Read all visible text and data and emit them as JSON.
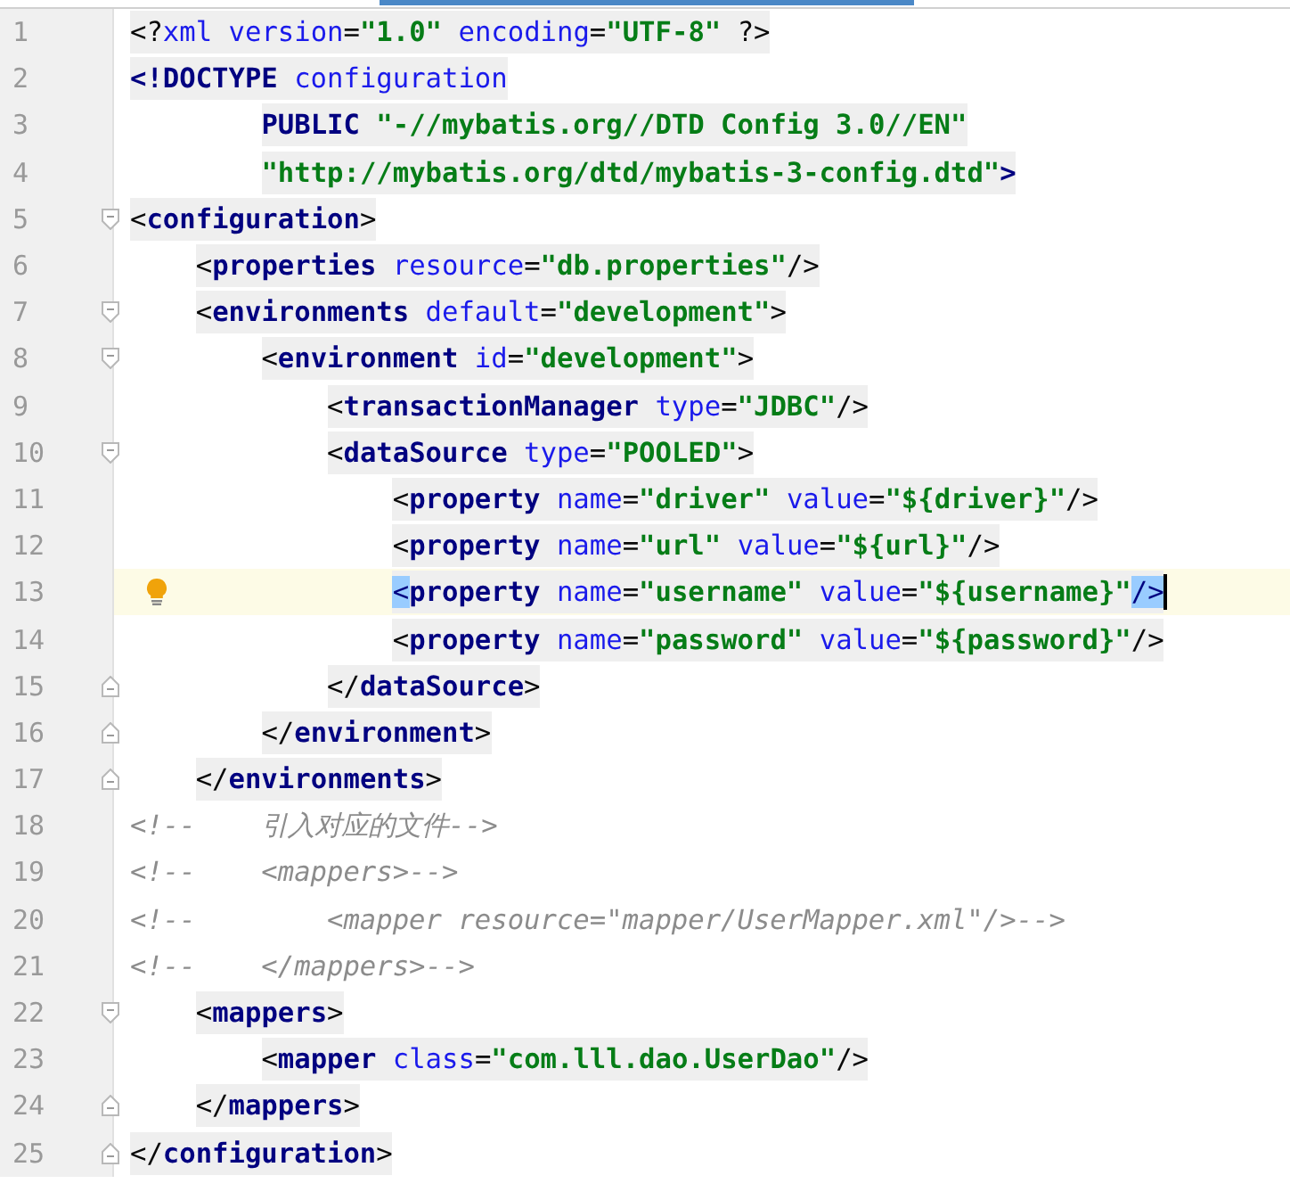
{
  "lines": [
    {
      "number": "1",
      "tokens": [
        {
          "kind": "punct",
          "text": "<?"
        },
        {
          "kind": "attr",
          "text": "xml"
        },
        {
          "kind": "attr",
          "text": " version"
        },
        {
          "kind": "punct",
          "text": "="
        },
        {
          "kind": "value",
          "text": "\"1.0\""
        },
        {
          "kind": "attr",
          "text": " encoding"
        },
        {
          "kind": "punct",
          "text": "="
        },
        {
          "kind": "value",
          "text": "\"UTF-8\""
        },
        {
          "kind": "punct",
          "text": " ?>"
        }
      ]
    },
    {
      "number": "2",
      "tokens": [
        {
          "kind": "tag",
          "text": "<!DOCTYPE"
        },
        {
          "kind": "attr",
          "text": " configuration"
        }
      ]
    },
    {
      "number": "3",
      "tokens": [
        {
          "kind": "tag",
          "text": "        PUBLIC"
        },
        {
          "kind": "value",
          "text": " \"-//mybatis.org//DTD Config 3.0//EN\""
        }
      ]
    },
    {
      "number": "4",
      "tokens": [
        {
          "kind": "value",
          "text": "        \"http://mybatis.org/dtd/mybatis-3-config.dtd\""
        },
        {
          "kind": "tag",
          "text": ">"
        }
      ]
    },
    {
      "number": "5",
      "fold_start": true,
      "tokens": [
        {
          "kind": "punct",
          "text": "<"
        },
        {
          "kind": "tag",
          "text": "configuration"
        },
        {
          "kind": "punct",
          "text": ">"
        }
      ]
    },
    {
      "number": "6",
      "tokens": [
        {
          "kind": "punct",
          "text": "    <"
        },
        {
          "kind": "tag",
          "text": "properties"
        },
        {
          "kind": "attr",
          "text": " resource"
        },
        {
          "kind": "punct",
          "text": "="
        },
        {
          "kind": "value",
          "text": "\"db.properties\""
        },
        {
          "kind": "punct",
          "text": "/>"
        }
      ]
    },
    {
      "number": "7",
      "fold_start": true,
      "tokens": [
        {
          "kind": "punct",
          "text": "    <"
        },
        {
          "kind": "tag",
          "text": "environments"
        },
        {
          "kind": "attr",
          "text": " default"
        },
        {
          "kind": "punct",
          "text": "="
        },
        {
          "kind": "value",
          "text": "\"development\""
        },
        {
          "kind": "punct",
          "text": ">"
        }
      ]
    },
    {
      "number": "8",
      "fold_start": true,
      "tokens": [
        {
          "kind": "punct",
          "text": "        <"
        },
        {
          "kind": "tag",
          "text": "environment"
        },
        {
          "kind": "attr",
          "text": " id"
        },
        {
          "kind": "punct",
          "text": "="
        },
        {
          "kind": "value",
          "text": "\"development\""
        },
        {
          "kind": "punct",
          "text": ">"
        }
      ]
    },
    {
      "number": "9",
      "tokens": [
        {
          "kind": "punct",
          "text": "            <"
        },
        {
          "kind": "tag",
          "text": "transactionManager"
        },
        {
          "kind": "attr",
          "text": " type"
        },
        {
          "kind": "punct",
          "text": "="
        },
        {
          "kind": "value",
          "text": "\"JDBC\""
        },
        {
          "kind": "punct",
          "text": "/>"
        }
      ]
    },
    {
      "number": "10",
      "fold_start": true,
      "tokens": [
        {
          "kind": "punct",
          "text": "            <"
        },
        {
          "kind": "tag",
          "text": "dataSource"
        },
        {
          "kind": "attr",
          "text": " type"
        },
        {
          "kind": "punct",
          "text": "="
        },
        {
          "kind": "value",
          "text": "\"POOLED\""
        },
        {
          "kind": "punct",
          "text": ">"
        }
      ]
    },
    {
      "number": "11",
      "tokens": [
        {
          "kind": "punct",
          "text": "                <"
        },
        {
          "kind": "tag",
          "text": "property"
        },
        {
          "kind": "attr",
          "text": " name"
        },
        {
          "kind": "punct",
          "text": "="
        },
        {
          "kind": "value",
          "text": "\"driver\""
        },
        {
          "kind": "attr",
          "text": " value"
        },
        {
          "kind": "punct",
          "text": "="
        },
        {
          "kind": "value",
          "text": "\"${driver}\""
        },
        {
          "kind": "punct",
          "text": "/>"
        }
      ]
    },
    {
      "number": "12",
      "tokens": [
        {
          "kind": "punct",
          "text": "                <"
        },
        {
          "kind": "tag",
          "text": "property"
        },
        {
          "kind": "attr",
          "text": " name"
        },
        {
          "kind": "punct",
          "text": "="
        },
        {
          "kind": "value",
          "text": "\"url\""
        },
        {
          "kind": "attr",
          "text": " value"
        },
        {
          "kind": "punct",
          "text": "="
        },
        {
          "kind": "value",
          "text": "\"${url}\""
        },
        {
          "kind": "punct",
          "text": "/>"
        }
      ]
    },
    {
      "number": "13",
      "current": true,
      "tokens": [
        {
          "kind": "match",
          "text": "                <"
        },
        {
          "kind": "tag",
          "text": "property"
        },
        {
          "kind": "attr",
          "text": " name"
        },
        {
          "kind": "punct",
          "text": "="
        },
        {
          "kind": "value",
          "text": "\"username\""
        },
        {
          "kind": "attr",
          "text": " value"
        },
        {
          "kind": "punct",
          "text": "="
        },
        {
          "kind": "value",
          "text": "\"${username}\""
        },
        {
          "kind": "match",
          "text": "/>"
        }
      ]
    },
    {
      "number": "14",
      "tokens": [
        {
          "kind": "punct",
          "text": "                <"
        },
        {
          "kind": "tag",
          "text": "property"
        },
        {
          "kind": "attr",
          "text": " name"
        },
        {
          "kind": "punct",
          "text": "="
        },
        {
          "kind": "value",
          "text": "\"password\""
        },
        {
          "kind": "attr",
          "text": " value"
        },
        {
          "kind": "punct",
          "text": "="
        },
        {
          "kind": "value",
          "text": "\"${password}\""
        },
        {
          "kind": "punct",
          "text": "/>"
        }
      ]
    },
    {
      "number": "15",
      "fold_end": true,
      "tokens": [
        {
          "kind": "punct",
          "text": "            </"
        },
        {
          "kind": "tag",
          "text": "dataSource"
        },
        {
          "kind": "punct",
          "text": ">"
        }
      ]
    },
    {
      "number": "16",
      "fold_end": true,
      "tokens": [
        {
          "kind": "punct",
          "text": "        </"
        },
        {
          "kind": "tag",
          "text": "environment"
        },
        {
          "kind": "punct",
          "text": ">"
        }
      ]
    },
    {
      "number": "17",
      "fold_end": true,
      "tokens": [
        {
          "kind": "punct",
          "text": "    </"
        },
        {
          "kind": "tag",
          "text": "environments"
        },
        {
          "kind": "punct",
          "text": ">"
        }
      ]
    },
    {
      "number": "18",
      "tokens": [
        {
          "kind": "comment",
          "text": "<!--    引入对应的文件-->"
        }
      ]
    },
    {
      "number": "19",
      "tokens": [
        {
          "kind": "comment",
          "text": "<!--    <mappers>-->"
        }
      ]
    },
    {
      "number": "20",
      "tokens": [
        {
          "kind": "comment",
          "text": "<!--        <mapper resource=\"mapper/UserMapper.xml\"/>-->"
        }
      ]
    },
    {
      "number": "21",
      "tokens": [
        {
          "kind": "comment",
          "text": "<!--    </mappers>-->"
        }
      ]
    },
    {
      "number": "22",
      "fold_start": true,
      "tokens": [
        {
          "kind": "punct",
          "text": "    <"
        },
        {
          "kind": "tag",
          "text": "mappers"
        },
        {
          "kind": "punct",
          "text": ">"
        }
      ]
    },
    {
      "number": "23",
      "tokens": [
        {
          "kind": "punct",
          "text": "        <"
        },
        {
          "kind": "tag",
          "text": "mapper"
        },
        {
          "kind": "attr",
          "text": " class"
        },
        {
          "kind": "punct",
          "text": "="
        },
        {
          "kind": "value",
          "text": "\"com.lll.dao.UserDao\""
        },
        {
          "kind": "punct",
          "text": "/>"
        }
      ]
    },
    {
      "number": "24",
      "fold_end": true,
      "tokens": [
        {
          "kind": "punct",
          "text": "    </"
        },
        {
          "kind": "tag",
          "text": "mappers"
        },
        {
          "kind": "punct",
          "text": ">"
        }
      ]
    },
    {
      "number": "25",
      "fold_end": true,
      "tokens": [
        {
          "kind": "punct",
          "text": "</"
        },
        {
          "kind": "tag",
          "text": "configuration"
        },
        {
          "kind": "punct",
          "text": ">"
        }
      ]
    }
  ]
}
